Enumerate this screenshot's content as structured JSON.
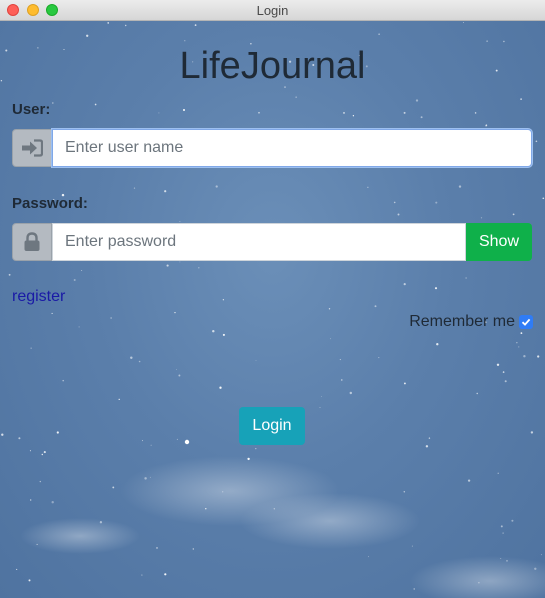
{
  "window": {
    "title": "Login"
  },
  "app": {
    "title": "LifeJournal"
  },
  "user": {
    "label": "User:",
    "placeholder": "Enter user name",
    "value": "",
    "icon": "sign-in-icon"
  },
  "password": {
    "label": "Password:",
    "placeholder": "Enter password",
    "value": "",
    "icon": "lock-icon",
    "show_label": "Show"
  },
  "register_label": "register",
  "remember": {
    "label": "Remember me",
    "checked": true
  },
  "login_label": "Login",
  "colors": {
    "show_button": "#0fb04a",
    "login_button": "#17a2b8",
    "checkbox": "#2f7cf6",
    "link": "#1a1aa6"
  }
}
